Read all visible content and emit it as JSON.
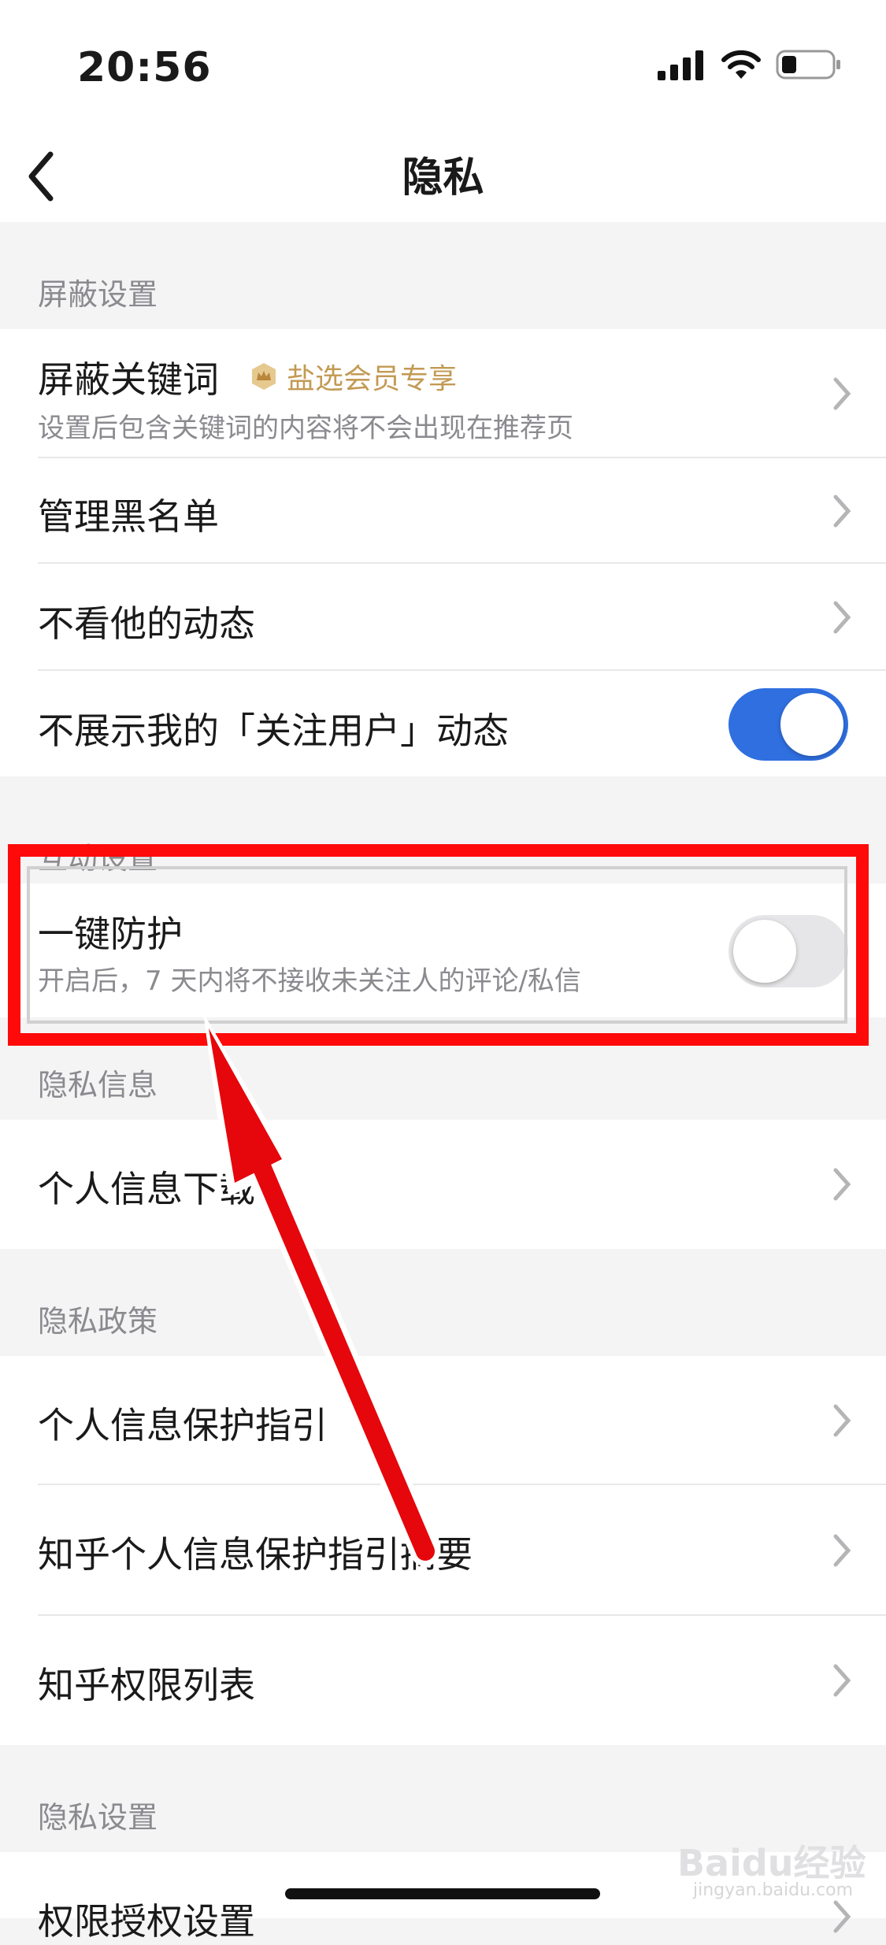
{
  "status_bar": {
    "time": "20:56"
  },
  "nav": {
    "title": "隐私"
  },
  "sections": {
    "shield": "屏蔽设置",
    "interaction": "互动设置",
    "privacy_info": "隐私信息",
    "privacy_policy": "隐私政策",
    "privacy_settings": "隐私设置"
  },
  "rows": {
    "block_keywords": {
      "label": "屏蔽关键词",
      "badge": "盐选会员专享",
      "sub": "设置后包含关键词的内容将不会出现在推荐页"
    },
    "blacklist": {
      "label": "管理黑名单"
    },
    "hide_their_feed": {
      "label": "不看他的动态"
    },
    "hide_following_feed": {
      "label": "不展示我的「关注用户」动态",
      "toggle": true
    },
    "one_click_protect": {
      "label": "一键防护",
      "sub": "开启后，7 天内将不接收未关注人的评论/私信",
      "toggle": false
    },
    "personal_info_download": {
      "label": "个人信息下载"
    },
    "info_protection_guide": {
      "label": "个人信息保护指引"
    },
    "info_protection_summary": {
      "label": "知乎个人信息保护指引摘要"
    },
    "permission_list": {
      "label": "知乎权限列表"
    },
    "permission_auth": {
      "label": "权限授权设置"
    }
  },
  "watermark": {
    "brand": "Baidu经验",
    "url": "jingyan.baidu.com"
  },
  "colors": {
    "accent": "#2f6fe0",
    "highlight": "#ff0a0a",
    "badge": "#c39a54"
  }
}
